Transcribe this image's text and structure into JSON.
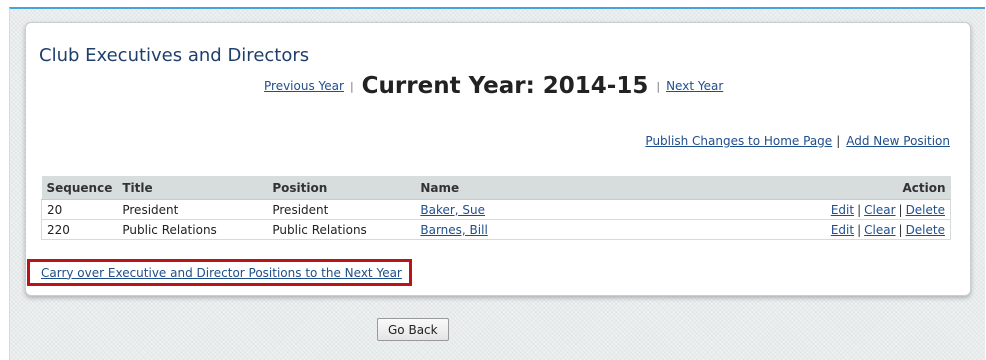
{
  "title": "Club Executives and Directors",
  "year_nav": {
    "previous_label": "Previous Year",
    "separator": "|",
    "current_year": "Current Year: 2014-15",
    "next_label": "Next Year"
  },
  "top_actions": {
    "publish_label": "Publish Changes to Home Page",
    "separator": "|",
    "add_label": "Add New Position"
  },
  "table": {
    "headers": {
      "sequence": "Sequence",
      "title": "Title",
      "position": "Position",
      "name": "Name",
      "action": "Action"
    },
    "rows": [
      {
        "sequence": "20",
        "title": "President",
        "position": "President",
        "name": "Baker, Sue"
      },
      {
        "sequence": "220",
        "title": "Public Relations",
        "position": "Public Relations",
        "name": "Barnes, Bill"
      }
    ],
    "actions": {
      "edit": "Edit",
      "clear": "Clear",
      "delete": "Delete",
      "separator": "|"
    }
  },
  "carry_over_label": "Carry over Executive and Director Positions to the Next Year",
  "go_back_label": "Go Back",
  "colors": {
    "accent_top_border": "#4aa3d8",
    "link": "#1f4e8c",
    "title": "#1f3f6b",
    "highlight_box": "#b8151b"
  }
}
